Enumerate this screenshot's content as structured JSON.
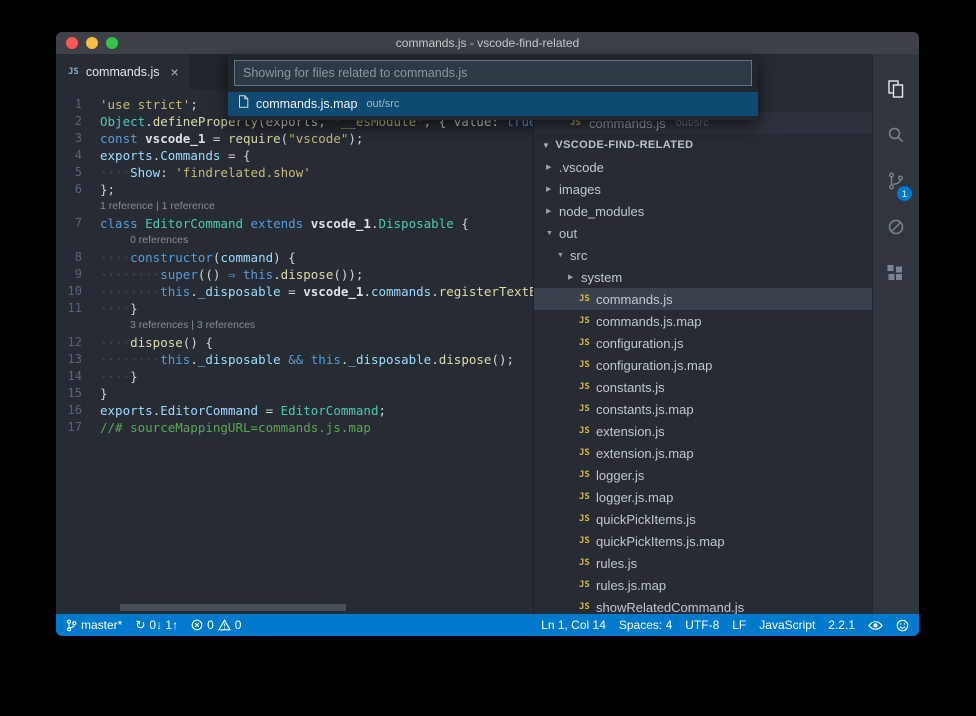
{
  "window": {
    "title": "commands.js - vscode-find-related"
  },
  "tab": {
    "label": "commands.js",
    "close_glyph": "×"
  },
  "quickpick": {
    "input": "Showing for files related to commands.js",
    "items": [
      {
        "label": "commands.js.map",
        "detail": "out/src"
      }
    ]
  },
  "editor": {
    "lines": [
      {
        "n": 1,
        "s": [
          {
            "t": "'use strict'",
            "c": "str"
          },
          {
            "t": ";",
            "c": "def"
          }
        ]
      },
      {
        "n": 2,
        "s": [
          {
            "t": "Object",
            "c": "type"
          },
          {
            "t": ".",
            "c": "def"
          },
          {
            "t": "defineProperty",
            "c": "fn"
          },
          {
            "t": "(exports, ",
            "c": "def"
          },
          {
            "t": "\"__esModule\"",
            "c": "str"
          },
          {
            "t": ", { value: ",
            "c": "def"
          },
          {
            "t": "true",
            "c": "kw"
          },
          {
            "t": " });",
            "c": "def"
          }
        ]
      },
      {
        "n": 3,
        "s": [
          {
            "t": "const ",
            "c": "kw"
          },
          {
            "t": "vscode_1",
            "c": "var"
          },
          {
            "t": " = ",
            "c": "def"
          },
          {
            "t": "require",
            "c": "fn"
          },
          {
            "t": "(",
            "c": "def"
          },
          {
            "t": "\"vscode\"",
            "c": "str"
          },
          {
            "t": ");",
            "c": "def"
          }
        ]
      },
      {
        "n": 4,
        "s": [
          {
            "t": "exports",
            "c": "prop"
          },
          {
            "t": ".",
            "c": "def"
          },
          {
            "t": "Commands",
            "c": "prop"
          },
          {
            "t": " = {",
            "c": "def"
          }
        ]
      },
      {
        "n": 5,
        "s": [
          {
            "t": "····",
            "c": "ws"
          },
          {
            "t": "Show",
            "c": "prop"
          },
          {
            "t": ": ",
            "c": "def"
          },
          {
            "t": "'findrelated.show'",
            "c": "str"
          }
        ]
      },
      {
        "n": 6,
        "s": [
          {
            "t": "};",
            "c": "def"
          }
        ]
      },
      {
        "lens": true,
        "s": [
          {
            "t": "1 reference | 1 reference",
            "c": "lens"
          }
        ]
      },
      {
        "n": 7,
        "s": [
          {
            "t": "class ",
            "c": "kw"
          },
          {
            "t": "EditorCommand",
            "c": "type"
          },
          {
            "t": " extends ",
            "c": "kw"
          },
          {
            "t": "vscode_1",
            "c": "var"
          },
          {
            "t": ".",
            "c": "def"
          },
          {
            "t": "Disposable",
            "c": "type"
          },
          {
            "t": " {",
            "c": "def"
          }
        ]
      },
      {
        "lens": true,
        "s": [
          {
            "t": "",
            "c": "sp"
          },
          {
            "t": "0 references",
            "c": "lens"
          }
        ]
      },
      {
        "n": 8,
        "s": [
          {
            "t": "····",
            "c": "ws"
          },
          {
            "t": "constructor",
            "c": "kw"
          },
          {
            "t": "(",
            "c": "def"
          },
          {
            "t": "command",
            "c": "prop"
          },
          {
            "t": ") {",
            "c": "def"
          }
        ]
      },
      {
        "n": 9,
        "s": [
          {
            "t": "········",
            "c": "ws"
          },
          {
            "t": "super",
            "c": "kw"
          },
          {
            "t": "(() ",
            "c": "def"
          },
          {
            "t": "⇒",
            "c": "kw"
          },
          {
            "t": " ",
            "c": "def"
          },
          {
            "t": "this",
            "c": "kw"
          },
          {
            "t": ".",
            "c": "def"
          },
          {
            "t": "dispose",
            "c": "fn"
          },
          {
            "t": "());",
            "c": "def"
          }
        ]
      },
      {
        "n": 10,
        "s": [
          {
            "t": "········",
            "c": "ws"
          },
          {
            "t": "this",
            "c": "kw"
          },
          {
            "t": ".",
            "c": "def"
          },
          {
            "t": "_disposable",
            "c": "prop"
          },
          {
            "t": " = ",
            "c": "def"
          },
          {
            "t": "vscode_1",
            "c": "var"
          },
          {
            "t": ".",
            "c": "def"
          },
          {
            "t": "commands",
            "c": "prop"
          },
          {
            "t": ".",
            "c": "def"
          },
          {
            "t": "registerTextE",
            "c": "fn"
          }
        ]
      },
      {
        "n": 11,
        "s": [
          {
            "t": "····",
            "c": "ws"
          },
          {
            "t": "}",
            "c": "def"
          }
        ]
      },
      {
        "lens": true,
        "s": [
          {
            "t": "",
            "c": "sp"
          },
          {
            "t": "3 references | 3 references",
            "c": "lens"
          }
        ]
      },
      {
        "n": 12,
        "s": [
          {
            "t": "····",
            "c": "ws"
          },
          {
            "t": "dispose",
            "c": "fn"
          },
          {
            "t": "() {",
            "c": "def"
          }
        ]
      },
      {
        "n": 13,
        "s": [
          {
            "t": "········",
            "c": "ws"
          },
          {
            "t": "this",
            "c": "kw"
          },
          {
            "t": ".",
            "c": "def"
          },
          {
            "t": "_disposable",
            "c": "prop"
          },
          {
            "t": " ",
            "c": "def"
          },
          {
            "t": "&&",
            "c": "kw"
          },
          {
            "t": " ",
            "c": "def"
          },
          {
            "t": "this",
            "c": "kw"
          },
          {
            "t": ".",
            "c": "def"
          },
          {
            "t": "_disposable",
            "c": "prop"
          },
          {
            "t": ".",
            "c": "def"
          },
          {
            "t": "dispose",
            "c": "fn"
          },
          {
            "t": "();",
            "c": "def"
          }
        ]
      },
      {
        "n": 14,
        "s": [
          {
            "t": "····",
            "c": "ws"
          },
          {
            "t": "}",
            "c": "def"
          }
        ]
      },
      {
        "n": 15,
        "s": [
          {
            "t": "}",
            "c": "def"
          }
        ]
      },
      {
        "n": 16,
        "s": [
          {
            "t": "exports",
            "c": "prop"
          },
          {
            "t": ".",
            "c": "def"
          },
          {
            "t": "EditorCommand",
            "c": "prop"
          },
          {
            "t": " = ",
            "c": "def"
          },
          {
            "t": "EditorCommand",
            "c": "type"
          },
          {
            "t": ";",
            "c": "def"
          }
        ]
      },
      {
        "n": 17,
        "s": [
          {
            "t": "//# sourceMappingURL=commands.js.map",
            "c": "cm"
          }
        ]
      }
    ]
  },
  "sidebar": {
    "open_editor": {
      "label": "commands.js",
      "detail": "out/src"
    },
    "section": "VSCODE-FIND-RELATED",
    "tree": [
      {
        "label": ".vscode",
        "type": "folder",
        "state": "collapsed",
        "indent": 0
      },
      {
        "label": "images",
        "type": "folder",
        "state": "collapsed",
        "indent": 0
      },
      {
        "label": "node_modules",
        "type": "folder",
        "state": "collapsed",
        "indent": 0
      },
      {
        "label": "out",
        "type": "folder",
        "state": "expanded",
        "indent": 0
      },
      {
        "label": "src",
        "type": "folder",
        "state": "expanded",
        "indent": 1
      },
      {
        "label": "system",
        "type": "folder",
        "state": "collapsed",
        "indent": 2
      },
      {
        "label": "commands.js",
        "type": "js",
        "indent": 2,
        "selected": true
      },
      {
        "label": "commands.js.map",
        "type": "js",
        "indent": 2
      },
      {
        "label": "configuration.js",
        "type": "js",
        "indent": 2
      },
      {
        "label": "configuration.js.map",
        "type": "js",
        "indent": 2
      },
      {
        "label": "constants.js",
        "type": "js",
        "indent": 2
      },
      {
        "label": "constants.js.map",
        "type": "js",
        "indent": 2
      },
      {
        "label": "extension.js",
        "type": "js",
        "indent": 2
      },
      {
        "label": "extension.js.map",
        "type": "js",
        "indent": 2
      },
      {
        "label": "logger.js",
        "type": "js",
        "indent": 2
      },
      {
        "label": "logger.js.map",
        "type": "js",
        "indent": 2
      },
      {
        "label": "quickPickItems.js",
        "type": "js",
        "indent": 2
      },
      {
        "label": "quickPickItems.js.map",
        "type": "js",
        "indent": 2
      },
      {
        "label": "rules.js",
        "type": "js",
        "indent": 2
      },
      {
        "label": "rules.js.map",
        "type": "js",
        "indent": 2
      },
      {
        "label": "showRelatedCommand.js",
        "type": "js",
        "indent": 2
      }
    ]
  },
  "activity_bar": {
    "badge": "1",
    "icons": [
      "explorer",
      "search",
      "source-control",
      "debug",
      "extensions"
    ]
  },
  "status_bar": {
    "branch": "master*",
    "sync": "0↓ 1↑",
    "errors": "0",
    "warnings": "0",
    "line_col": "Ln 1, Col 14",
    "indentation": "Spaces: 4",
    "encoding": "UTF-8",
    "eol": "LF",
    "language": "JavaScript",
    "version": "2.2.1"
  },
  "colors": {
    "status_bar": "#007acc",
    "quickpick_selection": "#0e4a71",
    "editor_background": "#272b33"
  }
}
